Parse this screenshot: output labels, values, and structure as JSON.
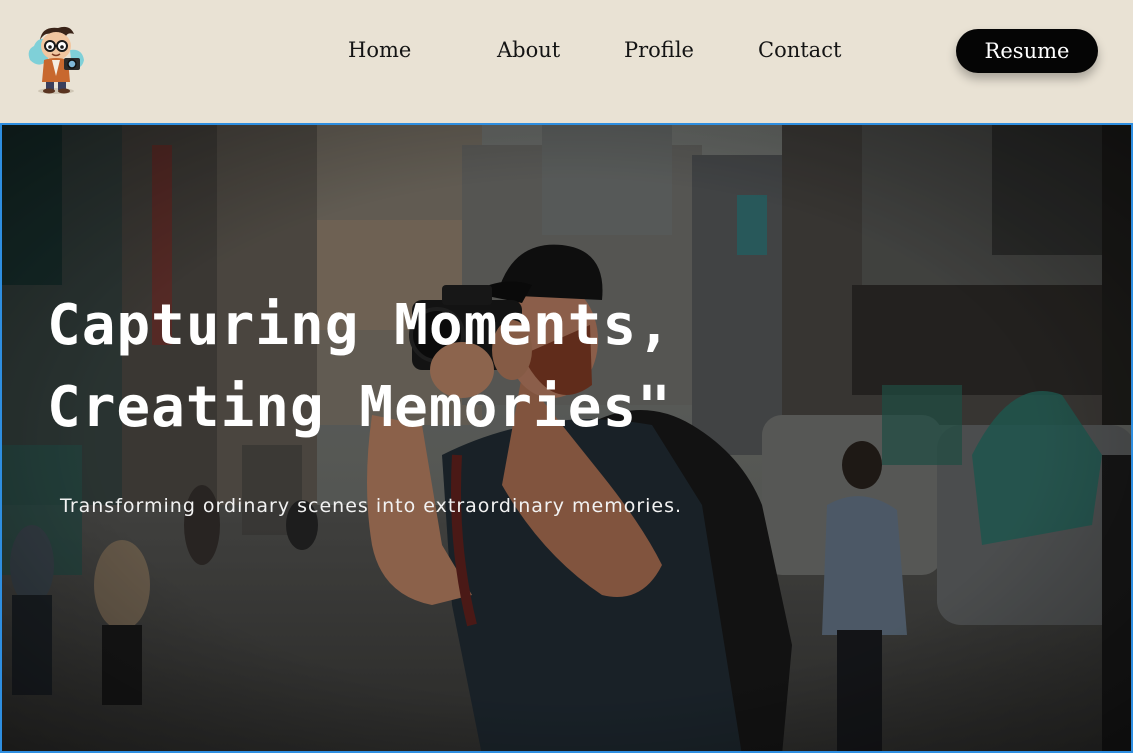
{
  "header": {
    "logo_icon": "cartoon-photographer-logo",
    "nav": {
      "home": "Home",
      "about": "About",
      "profile": "Profile",
      "contact": "Contact"
    },
    "resume_label": "Resume"
  },
  "hero": {
    "title_line1": "Capturing Moments,",
    "title_line2": "Creating Memories\"",
    "subtitle": "Transforming ordinary scenes into extraordinary memories.",
    "background_image": "street-photographer-photo"
  },
  "colors": {
    "header_bg": "#e9e2d4",
    "button_bg": "#050505",
    "hero_border": "#2e8ee0",
    "text_light": "#ffffff"
  }
}
